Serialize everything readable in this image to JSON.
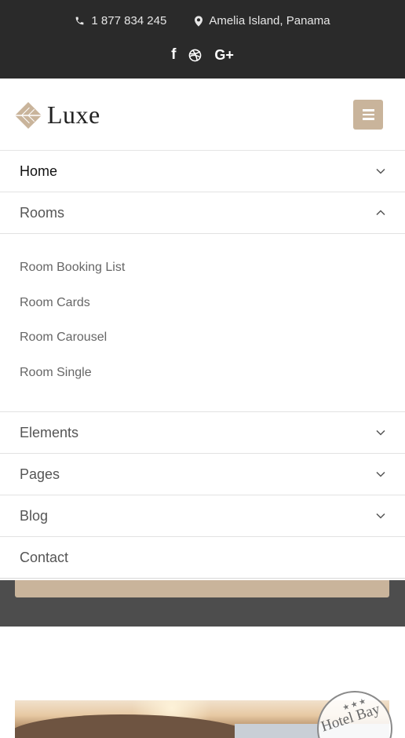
{
  "topbar": {
    "phone": "1 877 834 245",
    "location": "Amelia Island, Panama",
    "socials": [
      {
        "name": "facebook",
        "icon": "facebook-icon",
        "glyph": "f"
      },
      {
        "name": "dribbble",
        "icon": "dribbble-icon",
        "glyph": ""
      },
      {
        "name": "google-plus",
        "icon": "google-plus-icon",
        "glyph": "G+"
      }
    ]
  },
  "header": {
    "logo_text": "Luxe",
    "menu_icon": "hamburger-icon"
  },
  "nav": {
    "items": [
      {
        "label": "Home",
        "state": "collapsed",
        "active": true
      },
      {
        "label": "Rooms",
        "state": "expanded"
      },
      {
        "label": "Elements",
        "state": "collapsed"
      },
      {
        "label": "Pages",
        "state": "collapsed"
      },
      {
        "label": "Blog",
        "state": "collapsed"
      },
      {
        "label": "Contact",
        "state": "none"
      }
    ],
    "rooms_submenu": [
      "Room Booking List",
      "Room Cards",
      "Room Carousel",
      "Room Single"
    ]
  },
  "colors": {
    "topbar_bg": "#2a2a2a",
    "accent": "#c9b49b",
    "strip_bg": "#4d4d4d"
  },
  "stamp": {
    "text": "Hotel Bay",
    "stars": "★★★"
  }
}
